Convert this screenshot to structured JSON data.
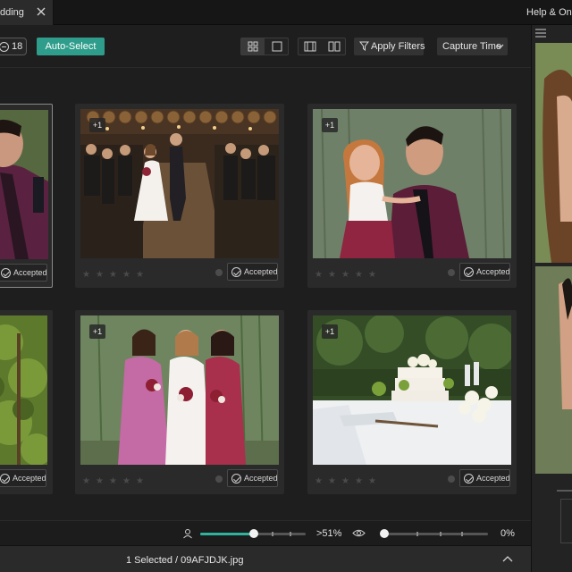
{
  "window": {
    "tab_label": "dding",
    "help_label": "Help & Onbo"
  },
  "toolbar": {
    "count": "18",
    "auto_select_label": "Auto-Select",
    "apply_filters_label": "Apply Filters",
    "sort_label": "Capture Time",
    "icons": {
      "filter": "filter-funnel-icon",
      "sort": "chevron-down-icon",
      "grid_view": "grid-view-icon",
      "single_view": "single-view-icon",
      "compare_view": "compare-view-icon",
      "split_view": "split-view-icon"
    }
  },
  "grid": {
    "accepted_label": "Accepted",
    "cards": [
      {
        "plus": "",
        "status": "Accepted",
        "selected": true,
        "scene": "groom-closeup"
      },
      {
        "plus": "+1",
        "status": "Accepted",
        "selected": false,
        "scene": "recessional-barrel-room"
      },
      {
        "plus": "+1",
        "status": "Accepted",
        "selected": false,
        "scene": "groom-with-flower-girl"
      },
      {
        "plus": "",
        "status": "Accepted",
        "selected": false,
        "scene": "vineyard"
      },
      {
        "plus": "+1",
        "status": "Accepted",
        "selected": false,
        "scene": "bride-with-bridesmaids"
      },
      {
        "plus": "+1",
        "status": "Accepted",
        "selected": false,
        "scene": "wedding-cake-table"
      }
    ]
  },
  "sliders": {
    "people_value": ">51%",
    "people_fraction": 0.51,
    "eye_value": "0%",
    "eye_fraction": 0.0,
    "accent_color": "#2fb39c"
  },
  "status": {
    "selection_text": "1 Selected / 09AFJDJK.jpg"
  },
  "colors": {
    "accent": "#2f9d8b",
    "background": "#1e1e1e",
    "card": "#2a2a2a"
  }
}
